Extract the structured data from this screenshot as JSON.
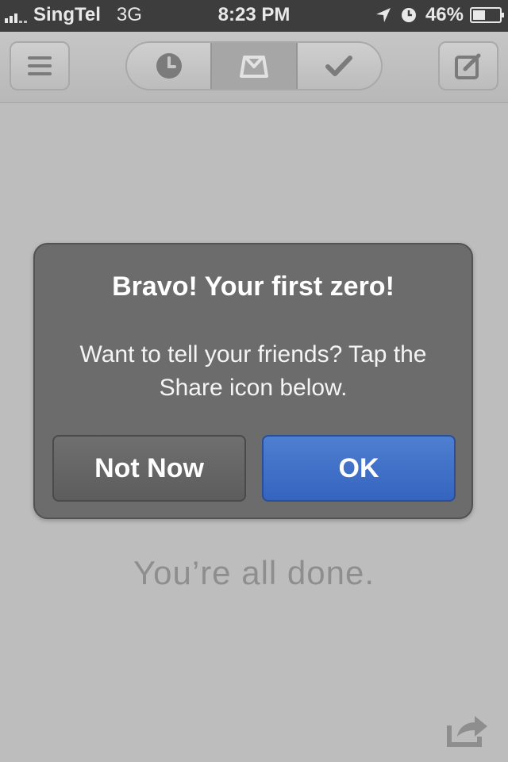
{
  "status_bar": {
    "carrier": "SingTel",
    "network": "3G",
    "time": "8:23 PM",
    "battery_percent": "46%",
    "battery_level": 0.46
  },
  "nav": {
    "menu_icon": "hamburger-icon",
    "tabs": [
      {
        "icon": "clock-icon",
        "active": false
      },
      {
        "icon": "inbox-icon",
        "active": true
      },
      {
        "icon": "checkmark-icon",
        "active": false
      }
    ],
    "compose_icon": "compose-icon"
  },
  "alert": {
    "title": "Bravo! Your first zero!",
    "message": "Want to tell your friends? Tap the Share icon below.",
    "buttons": {
      "cancel": "Not Now",
      "confirm": "OK"
    },
    "colors": {
      "confirm": "#3c6cc6"
    }
  },
  "main": {
    "status_text": "You’re all done."
  }
}
